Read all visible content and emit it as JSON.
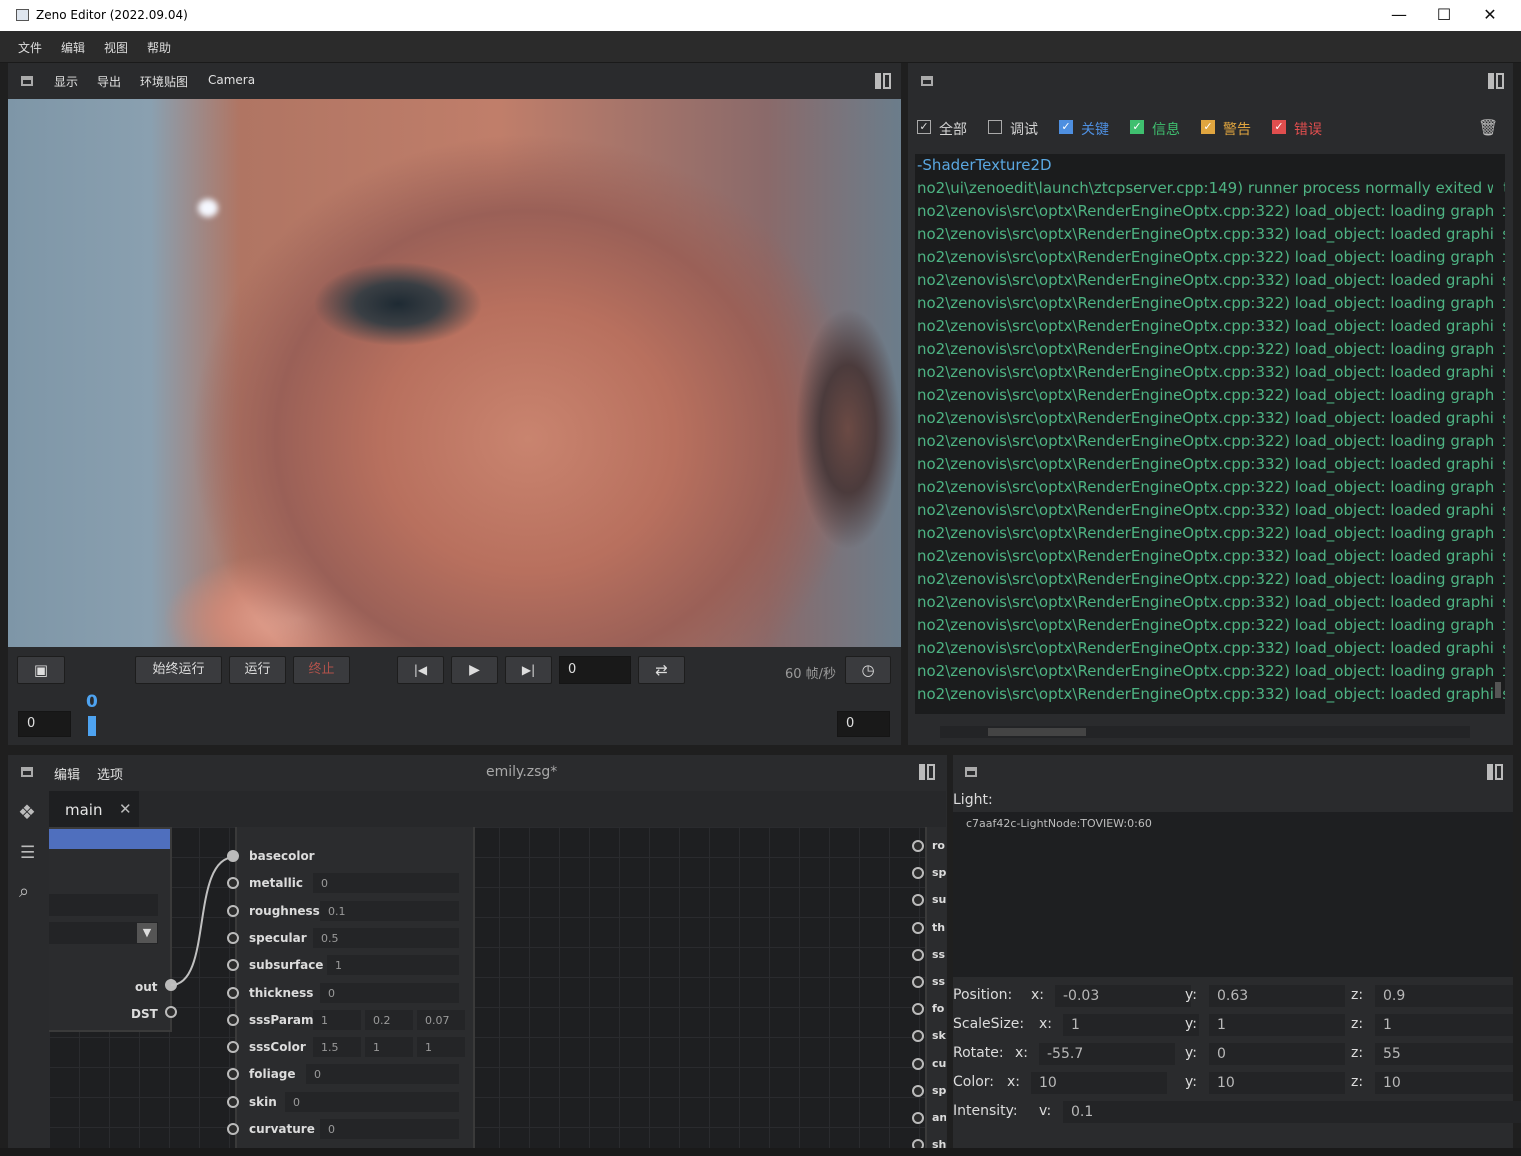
{
  "window": {
    "title": "Zeno Editor (2022.09.04)",
    "minimize": "—",
    "maximize": "☐",
    "close": "✕"
  },
  "menu": [
    "文件",
    "编辑",
    "视图",
    "帮助"
  ],
  "viewport_toolbar": [
    "显示",
    "导出",
    "环境贴图",
    "Camera"
  ],
  "playback": {
    "run_always": "始终运行",
    "run": "运行",
    "stop": "终止",
    "frame_value": "0",
    "fps_label": "60 帧/秒",
    "timeline_start": "0",
    "timeline_marker": "0",
    "timeline_end": "0"
  },
  "log_filters": [
    {
      "label": "全部",
      "checked": true,
      "color": "#d4d4d4"
    },
    {
      "label": "调试",
      "checked": false,
      "color": "#d4d4d4"
    },
    {
      "label": "关键",
      "checked": true,
      "color": "#4e8fe0"
    },
    {
      "label": "信息",
      "checked": true,
      "color": "#3fbf6f"
    },
    {
      "label": "警告",
      "checked": true,
      "color": "#e0a53f"
    },
    {
      "label": "错误",
      "checked": true,
      "color": "#e04e4e"
    }
  ],
  "log_lines": [
    "-ShaderTexture2D",
    "no2\\ui\\zenoedit\\launch\\ztcpserver.cpp:149) runner process normally exited with",
    "no2\\zenovis\\src\\optx\\RenderEngineOptx.cpp:322) load_object: loading graphic",
    "no2\\zenovis\\src\\optx\\RenderEngineOptx.cpp:332) load_object: loaded graphics",
    "no2\\zenovis\\src\\optx\\RenderEngineOptx.cpp:322) load_object: loading graphic",
    "no2\\zenovis\\src\\optx\\RenderEngineOptx.cpp:332) load_object: loaded graphics",
    "no2\\zenovis\\src\\optx\\RenderEngineOptx.cpp:322) load_object: loading graphic",
    "no2\\zenovis\\src\\optx\\RenderEngineOptx.cpp:332) load_object: loaded graphics",
    "no2\\zenovis\\src\\optx\\RenderEngineOptx.cpp:322) load_object: loading graphic",
    "no2\\zenovis\\src\\optx\\RenderEngineOptx.cpp:332) load_object: loaded graphics",
    "no2\\zenovis\\src\\optx\\RenderEngineOptx.cpp:322) load_object: loading graphic",
    "no2\\zenovis\\src\\optx\\RenderEngineOptx.cpp:332) load_object: loaded graphics",
    "no2\\zenovis\\src\\optx\\RenderEngineOptx.cpp:322) load_object: loading graphic",
    "no2\\zenovis\\src\\optx\\RenderEngineOptx.cpp:332) load_object: loaded graphics",
    "no2\\zenovis\\src\\optx\\RenderEngineOptx.cpp:322) load_object: loading graphic",
    "no2\\zenovis\\src\\optx\\RenderEngineOptx.cpp:332) load_object: loaded graphics",
    "no2\\zenovis\\src\\optx\\RenderEngineOptx.cpp:322) load_object: loading graphic",
    "no2\\zenovis\\src\\optx\\RenderEngineOptx.cpp:332) load_object: loaded graphics",
    "no2\\zenovis\\src\\optx\\RenderEngineOptx.cpp:322) load_object: loading graphic",
    "no2\\zenovis\\src\\optx\\RenderEngineOptx.cpp:332) load_object: loaded graphics",
    "no2\\zenovis\\src\\optx\\RenderEngineOptx.cpp:322) load_object: loading graphic",
    "no2\\zenovis\\src\\optx\\RenderEngineOptx.cpp:332) load_object: loaded graphics",
    "no2\\zenovis\\src\\optx\\RenderEngineOptx.cpp:322) load_object: loading graphic",
    "no2\\zenovis\\src\\optx\\RenderEngineOptx.cpp:332) load_object: loaded graphics"
  ],
  "editor": {
    "menu": [
      "编辑",
      "选项"
    ],
    "file_title": "emily.zsg*",
    "tab_label": "main",
    "left_node_outputs": [
      "out",
      "DST"
    ],
    "node_inputs": [
      {
        "name": "basecolor",
        "values": []
      },
      {
        "name": "metallic",
        "values": [
          "0"
        ]
      },
      {
        "name": "roughness",
        "values": [
          "0.1"
        ]
      },
      {
        "name": "specular",
        "values": [
          "0.5"
        ]
      },
      {
        "name": "subsurface",
        "values": [
          "1"
        ]
      },
      {
        "name": "thickness",
        "values": [
          "0"
        ]
      },
      {
        "name": "sssParam",
        "values": [
          "1",
          "0.2",
          "0.07"
        ]
      },
      {
        "name": "sssColor",
        "values": [
          "1.5",
          "1",
          "1"
        ]
      },
      {
        "name": "foliage",
        "values": [
          "0"
        ]
      },
      {
        "name": "skin",
        "values": [
          "0"
        ]
      },
      {
        "name": "curvature",
        "values": [
          "0"
        ]
      }
    ],
    "right_node_pins": [
      "ro",
      "sp",
      "su",
      "th",
      "ss",
      "ss",
      "fo",
      "sk",
      "cu",
      "sp",
      "an",
      "sh"
    ]
  },
  "properties": {
    "header": "Light:",
    "node_id": "c7aaf42c-LightNode:TOVIEW:0:60",
    "rows": [
      {
        "label": "Position:",
        "fields": [
          {
            "axis": "x:",
            "value": "-0.03"
          },
          {
            "axis": "y:",
            "value": "0.63"
          },
          {
            "axis": "z:",
            "value": "0.9"
          }
        ]
      },
      {
        "label": "ScaleSize:",
        "fields": [
          {
            "axis": "x:",
            "value": "1"
          },
          {
            "axis": "y:",
            "value": "1"
          },
          {
            "axis": "z:",
            "value": "1"
          }
        ]
      },
      {
        "label": "Rotate:",
        "fields": [
          {
            "axis": "x:",
            "value": "-55.7"
          },
          {
            "axis": "y:",
            "value": "0"
          },
          {
            "axis": "z:",
            "value": "55"
          }
        ]
      },
      {
        "label": "Color:",
        "fields": [
          {
            "axis": "x:",
            "value": "10"
          },
          {
            "axis": "y:",
            "value": "10"
          },
          {
            "axis": "z:",
            "value": "10"
          }
        ]
      },
      {
        "label": "Intensity:",
        "fields": [
          {
            "axis": "v:",
            "value": "0.1"
          }
        ]
      }
    ]
  }
}
